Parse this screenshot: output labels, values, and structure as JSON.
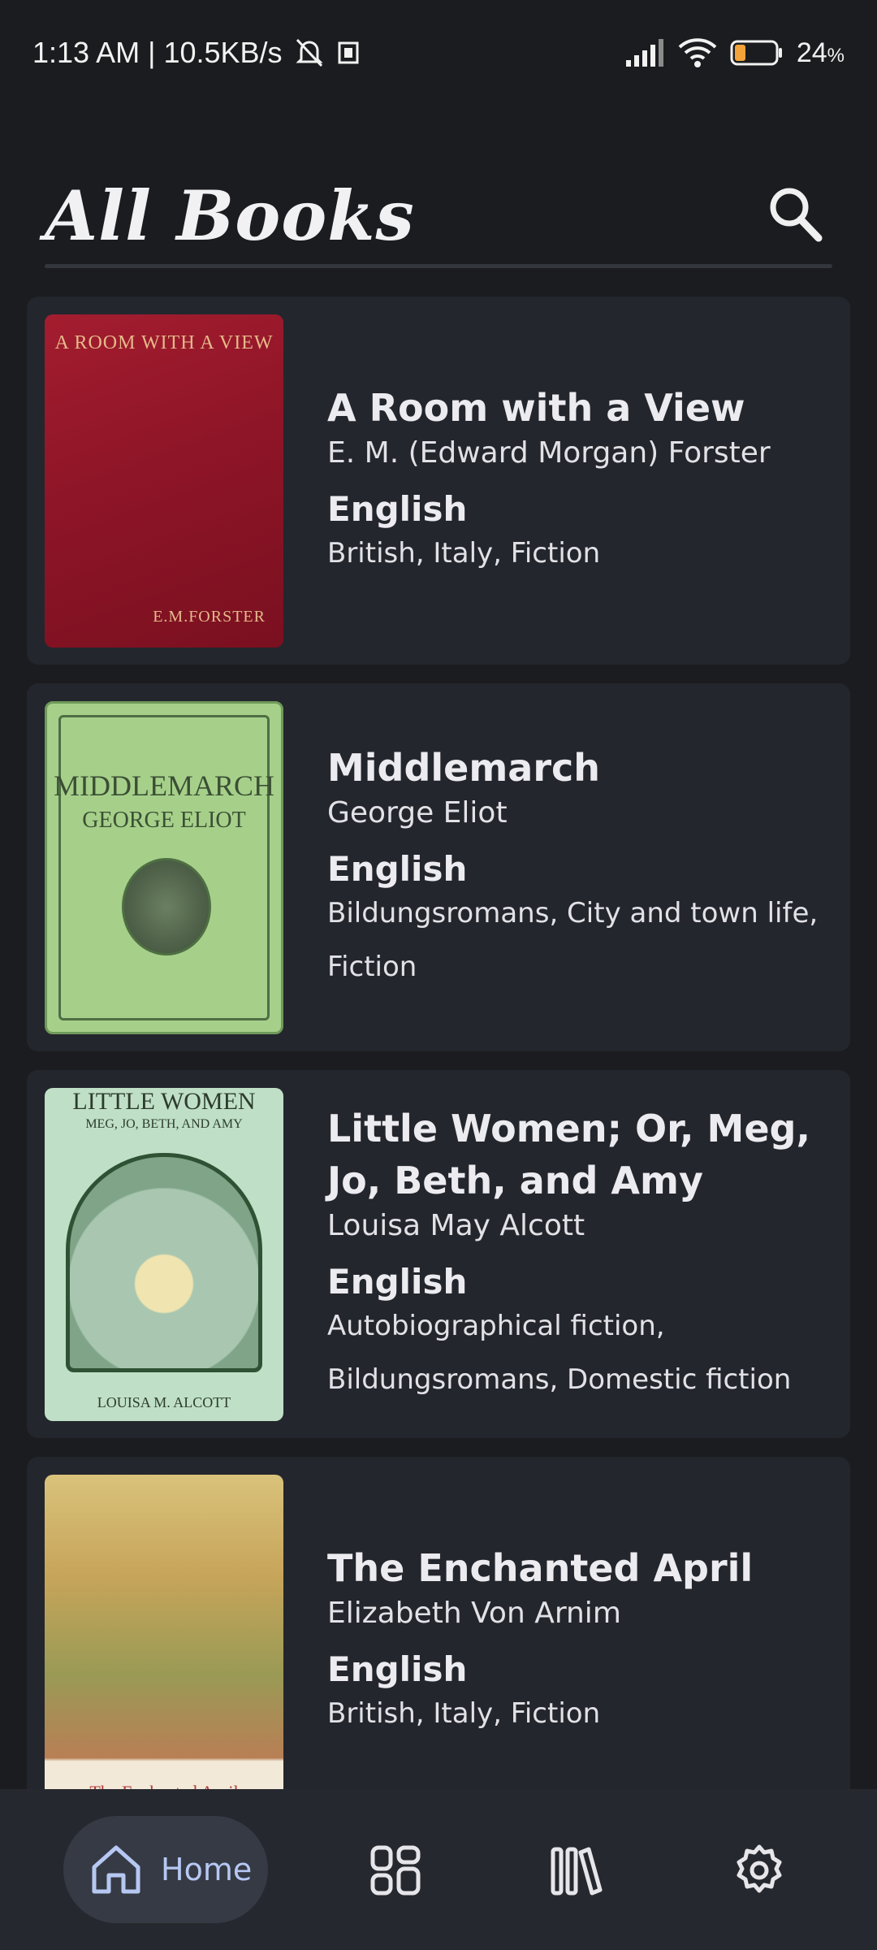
{
  "status_bar": {
    "time_speed": "1:13 AM | 10.5KB/s",
    "battery_percent": "24",
    "battery_unit": "%",
    "icons": [
      "mute-bell-icon",
      "sim-icon",
      "signal-icon",
      "wifi-icon",
      "battery-icon"
    ]
  },
  "header": {
    "title": "All Books",
    "search_icon": "search-icon"
  },
  "books": [
    {
      "title": "A Room with a View",
      "author": "E. M. (Edward Morgan) Forster",
      "language": "English",
      "subjects": "British, Italy, Fiction",
      "cover_title": "A ROOM WITH A VIEW",
      "cover_author": "E.M.FORSTER"
    },
    {
      "title": "Middlemarch",
      "author": "George Eliot",
      "language": "English",
      "subjects": "Bildungsromans, City and town life, Fiction",
      "cover_title": "MIDDLEMARCH",
      "cover_author": "GEORGE ELIOT"
    },
    {
      "title": "Little Women; Or, Meg, Jo, Beth, and Amy",
      "author": "Louisa May Alcott",
      "language": "English",
      "subjects": "Autobiographical fiction, Bildungsromans, Domestic fiction",
      "cover_title": "LITTLE WOMEN",
      "cover_subtitle": "MEG, JO, BETH, AND AMY",
      "cover_author": "LOUISA M. ALCOTT"
    },
    {
      "title": "The Enchanted April",
      "author": "Elizabeth Von Arnim",
      "language": "English",
      "subjects": "British, Italy, Fiction",
      "cover_title": "The Enchanted April"
    }
  ],
  "bottom_nav": {
    "home_label": "Home",
    "items": [
      "home-icon",
      "categories-icon",
      "library-icon",
      "settings-icon"
    ],
    "active_color": "#b6c8f2"
  }
}
